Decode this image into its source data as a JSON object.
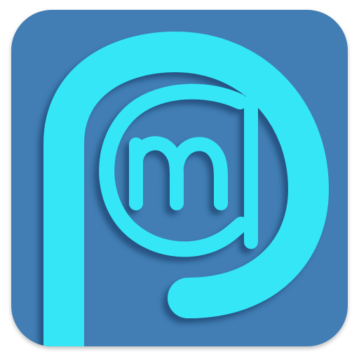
{
  "app_icon": {
    "name": "pm-app-icon",
    "glyph_letters": "pm",
    "colors": {
      "tile": "#437eb4",
      "tile_shadow": "#2f5f8e",
      "glyph": "#35e6f7",
      "glyph_shadow": "#1d4c78",
      "background": "#ffffff"
    }
  }
}
